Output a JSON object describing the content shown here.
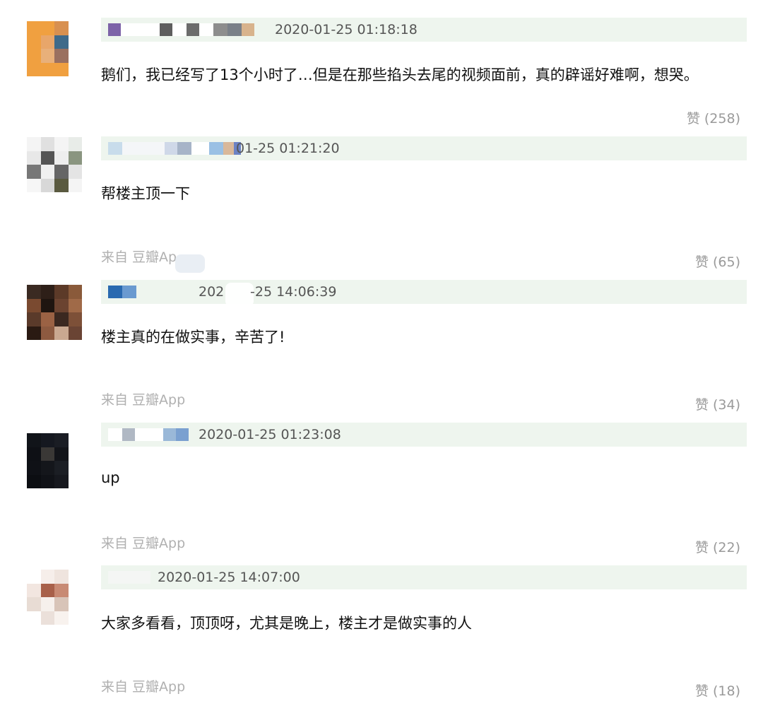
{
  "comments": [
    {
      "timestamp": "2020-01-25 01:18:18",
      "text": "鹅们，我已经写了13个小时了…但是在那些掐头去尾的视频面前，真的辟谣好难啊，想哭。",
      "source": "",
      "likes": "赞 (258)"
    },
    {
      "timestamp": "01-25 01:21:20",
      "text": "帮楼主顶一下",
      "source": "来自 豆瓣Ap",
      "likes": "赞 (65)"
    },
    {
      "timestamp_left": "202",
      "timestamp": "-25 14:06:39",
      "text": "楼主真的在做实事，辛苦了!",
      "source": "来自 豆瓣App",
      "likes": "赞 (34)"
    },
    {
      "timestamp": "2020-01-25 01:23:08",
      "text": "up",
      "source": "来自 豆瓣App",
      "likes": "赞 (22)"
    },
    {
      "timestamp": "2020-01-25 14:07:00",
      "text": "大家多看看，顶顶呀，尤其是晚上，楼主才是做实事的人",
      "source": "来自 豆瓣App",
      "likes": "赞 (18)"
    }
  ],
  "colors": {
    "meta_bar": "#eef5ee",
    "text": "#111111",
    "muted": "#b0b0b0"
  }
}
